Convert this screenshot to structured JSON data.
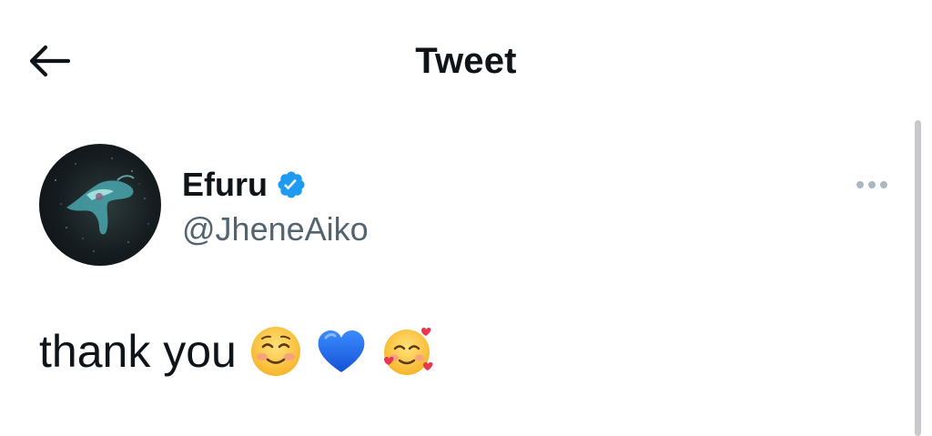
{
  "header": {
    "title": "Tweet",
    "back_icon": "arrow-left-icon"
  },
  "tweet": {
    "author": {
      "name": "Efuru",
      "handle": "@JheneAiko",
      "verified": true,
      "verified_color": "#1d9bf0"
    },
    "text": "thank you",
    "emojis": [
      "smiling-face-icon",
      "blue-heart-icon",
      "smiling-face-with-hearts-icon"
    ],
    "more_icon": "more-horizontal-icon"
  },
  "colors": {
    "text": "#0f1419",
    "secondary": "#536471",
    "accent": "#1d9bf0"
  }
}
